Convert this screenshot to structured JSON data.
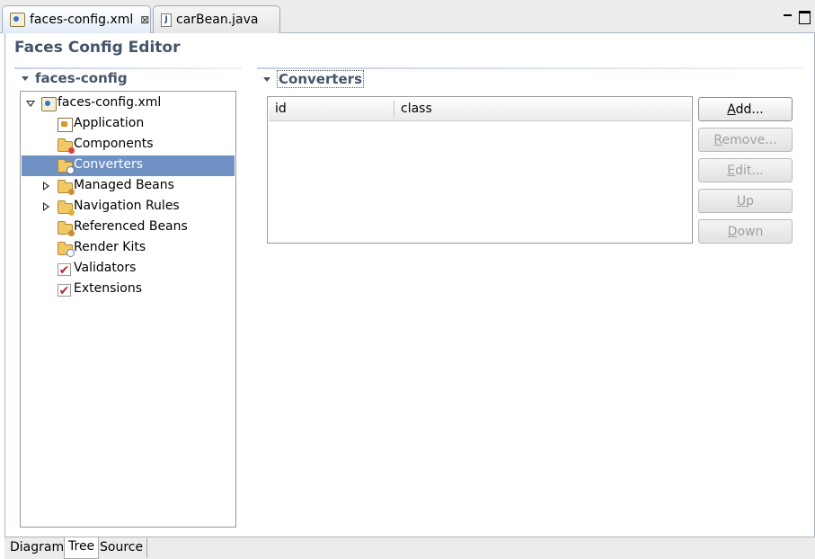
{
  "editor_tabs": [
    {
      "label": "faces-config.xml",
      "active": true,
      "closable": true,
      "icon": "faces-config-file-icon"
    },
    {
      "label": "carBean.java",
      "active": false,
      "closable": false,
      "icon": "java-file-icon"
    }
  ],
  "editor": {
    "title": "Faces Config Editor"
  },
  "left_section": {
    "title": "faces-config"
  },
  "tree": {
    "root": {
      "label": "faces-config.xml",
      "expanded": true
    },
    "items": [
      {
        "label": "Application",
        "icon": "application-icon",
        "expandable": false
      },
      {
        "label": "Components",
        "icon": "components-folder-icon",
        "expandable": false
      },
      {
        "label": "Converters",
        "icon": "converters-folder-icon",
        "expandable": false,
        "selected": true
      },
      {
        "label": "Managed Beans",
        "icon": "managed-beans-folder-icon",
        "expandable": true
      },
      {
        "label": "Navigation Rules",
        "icon": "navigation-rules-folder-icon",
        "expandable": true
      },
      {
        "label": "Referenced Beans",
        "icon": "referenced-beans-folder-icon",
        "expandable": false
      },
      {
        "label": "Render Kits",
        "icon": "render-kits-folder-icon",
        "expandable": false
      },
      {
        "label": "Validators",
        "icon": "validators-check-icon",
        "expandable": false
      },
      {
        "label": "Extensions",
        "icon": "extensions-check-icon",
        "expandable": false
      }
    ]
  },
  "right_section": {
    "title": "Converters"
  },
  "converters_table": {
    "columns": [
      "id",
      "class"
    ],
    "rows": []
  },
  "buttons": {
    "add": {
      "mnemonic": "A",
      "rest": "dd...",
      "enabled": true
    },
    "remove": {
      "mnemonic": "R",
      "rest": "emove...",
      "enabled": false
    },
    "edit": {
      "mnemonic": "E",
      "rest": "dit...",
      "enabled": false
    },
    "up": {
      "mnemonic": "U",
      "rest": "p",
      "enabled": false
    },
    "down": {
      "mnemonic": "D",
      "rest": "own",
      "enabled": false
    }
  },
  "bottom_tabs": [
    {
      "label": "Diagram",
      "active": false
    },
    {
      "label": "Tree",
      "active": true
    },
    {
      "label": "Source",
      "active": false
    }
  ],
  "colors": {
    "section_title": "#44556b",
    "selection": "#6f91c3",
    "folder": "#f2c867"
  }
}
